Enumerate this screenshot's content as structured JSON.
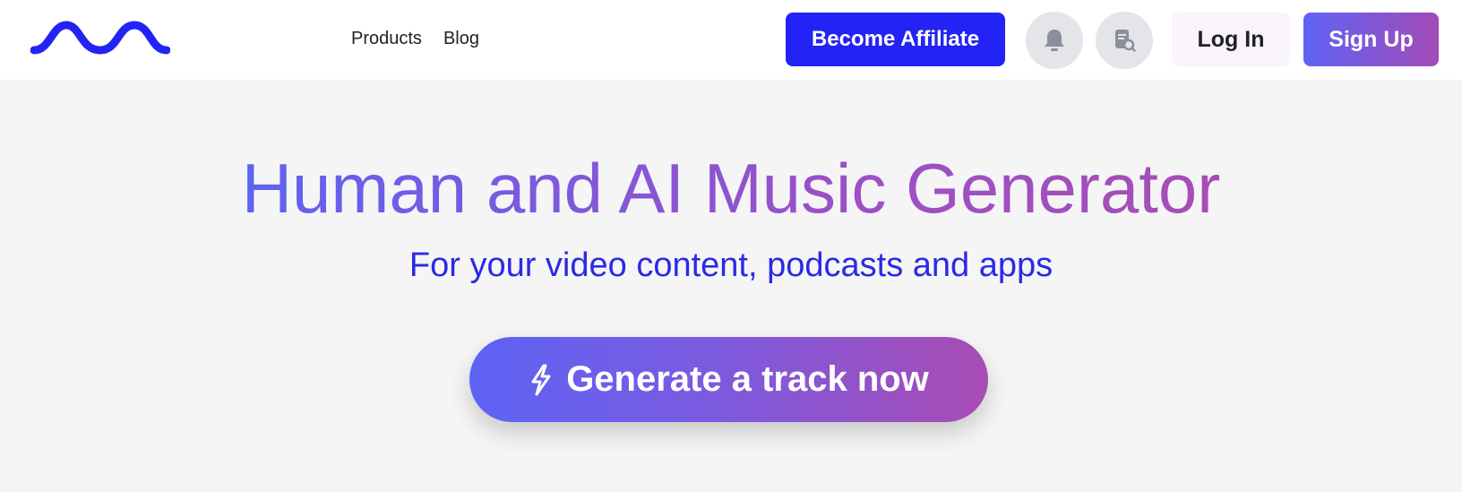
{
  "header": {
    "logo_name": "wave-logo",
    "nav": [
      {
        "label": "Products"
      },
      {
        "label": "Blog"
      }
    ],
    "become_affiliate_label": "Become Affiliate",
    "notifications_icon": "bell-icon",
    "document_search_icon": "document-search-icon",
    "login_label": "Log In",
    "signup_label": "Sign Up"
  },
  "hero": {
    "title": "Human and AI Music Generator",
    "subtitle": "For your video content, podcasts and apps",
    "cta_label": "Generate a track now",
    "cta_icon": "lightning-icon"
  },
  "colors": {
    "brand_blue": "#2323f5",
    "gradient_start": "#5f63f5",
    "gradient_end": "#a24cb7",
    "background": "#f5f5f5",
    "header_background": "#ffffff"
  }
}
